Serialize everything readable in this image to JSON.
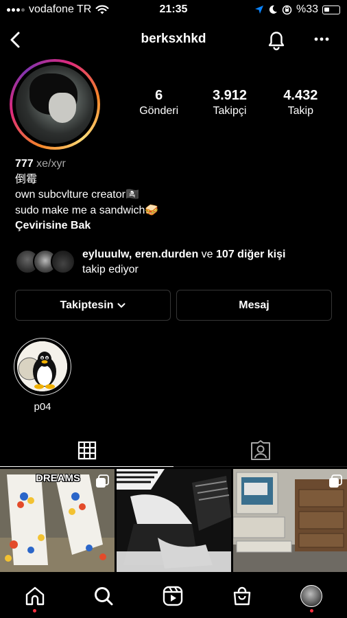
{
  "status": {
    "carrier": "vodafone TR",
    "time": "21:35",
    "battery": "%33"
  },
  "header": {
    "username": "berksxhkd"
  },
  "profile": {
    "stats": [
      {
        "value": "6",
        "label": "Gönderi"
      },
      {
        "value": "3.912",
        "label": "Takipçi"
      },
      {
        "value": "4.432",
        "label": "Takip"
      }
    ],
    "name": "777",
    "pronouns": "xe/xyr",
    "bio_lines": [
      "倒霉",
      "own subcvlture creator🏴‍☠️",
      "sudo make me a sandwich🥪"
    ],
    "see_translation": "Çevirisine Bak"
  },
  "followed_by": {
    "user1": "eyluuulw",
    "user2": "eren.durden",
    "connector": "ve",
    "others": "107 diğer kişi",
    "suffix": "takip ediyor"
  },
  "buttons": {
    "following": "Takiptesin",
    "message": "Mesaj"
  },
  "highlights": [
    {
      "label": "p04"
    }
  ],
  "posts": [
    {
      "caption_text": "DREAMS"
    },
    {
      "caption_text": ""
    },
    {
      "caption_text": ""
    }
  ],
  "icons": {
    "back": "chevron-left-icon",
    "bell": "bell-icon",
    "more": "more-horizontal-icon",
    "grid": "grid-icon",
    "tagged": "tagged-person-icon",
    "home": "home-icon",
    "search": "search-icon",
    "reels": "reels-icon",
    "shop": "shop-bag-icon",
    "profile": "profile-avatar-icon"
  },
  "colors": {
    "background": "#000000",
    "notification_dot": "#ff3040",
    "button_border": "#363636"
  }
}
